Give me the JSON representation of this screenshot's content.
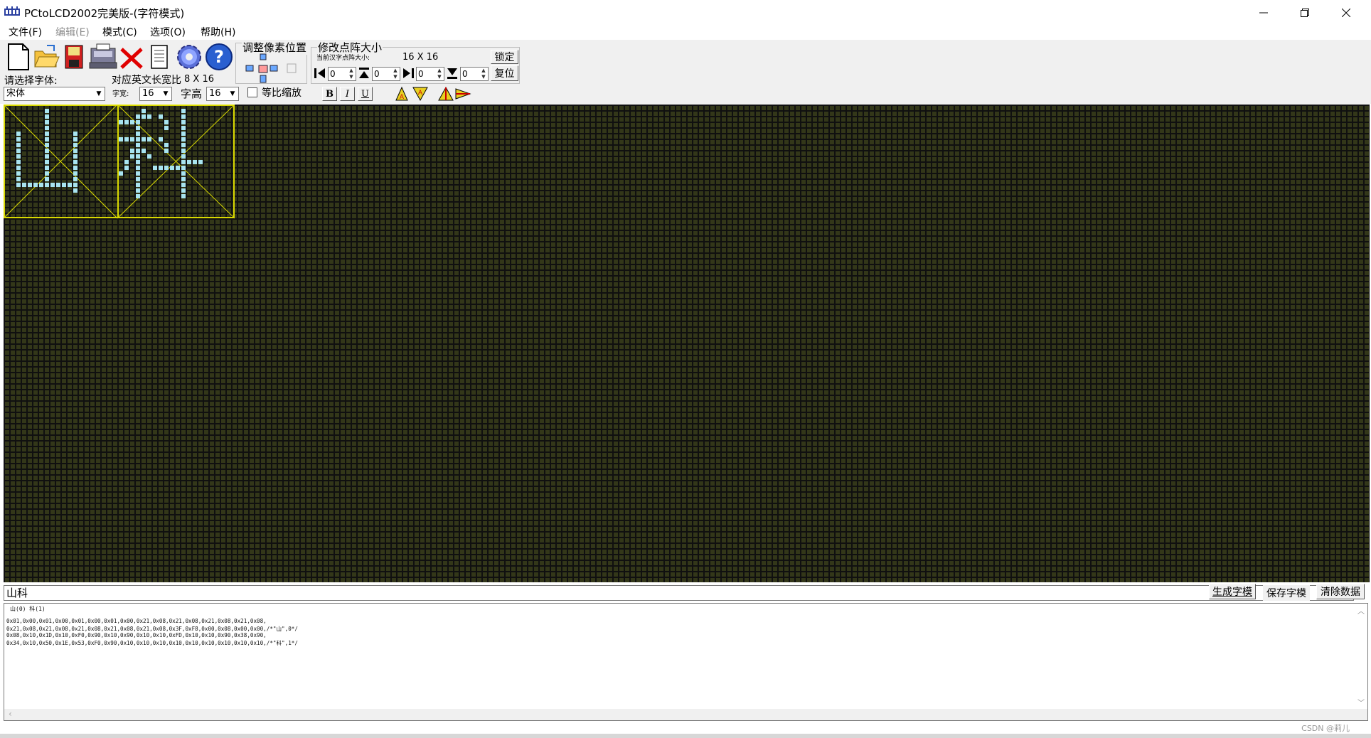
{
  "window": {
    "title": "PCtoLCD2002完美版-(字符模式)",
    "minimize": "−",
    "restore": "❐",
    "close": "✕"
  },
  "menu": [
    {
      "label": "文件(F)",
      "enabled": true
    },
    {
      "label": "编辑(E)",
      "enabled": false
    },
    {
      "label": "模式(C)",
      "enabled": true
    },
    {
      "label": "选项(O)",
      "enabled": true
    },
    {
      "label": "帮助(H)",
      "enabled": true
    }
  ],
  "toolbar": {
    "font_label": "请选择字体:",
    "font_value": "宋体",
    "ratio_label": "对应英文长宽比",
    "ratio_value": "8 X 16",
    "char_width_label": "字宽:",
    "char_width_value": "16",
    "char_height_label": "字高",
    "char_height_value": "16",
    "proportional_label": "等比缩放",
    "bold": "B",
    "italic": "I",
    "underline": "U",
    "adjust_title": "调整像素位置",
    "resize_title": "修改点阵大小",
    "current_size_label": "当前汉字点阵大小:",
    "current_size_value": "16 X 16",
    "lock_button": "锁定",
    "reset_button": "复位",
    "spin_values": [
      "0",
      "0",
      "0",
      "0"
    ]
  },
  "editor": {
    "chars": [
      "山",
      "科"
    ]
  },
  "bottom": {
    "input_text": "山科",
    "generate_button": "生成字模",
    "save_button": "保存字模",
    "clear_button": "清除数据",
    "output_header": "山(0) 科(1)",
    "output_lines": [
      "0x01,0x00,0x01,0x00,0x01,0x00,0x01,0x00,0x21,0x08,0x21,0x08,0x21,0x08,0x21,0x08,",
      "0x21,0x08,0x21,0x08,0x21,0x08,0x21,0x08,0x21,0x08,0x3F,0xF8,0x00,0x08,0x00,0x00,/*\"山\",0*/",
      "0x08,0x10,0x1D,0x10,0xF0,0x90,0x10,0x90,0x10,0x10,0xFD,0x10,0x10,0x90,0x38,0x90,",
      "0x34,0x10,0x50,0x1E,0x53,0xF0,0x90,0x10,0x10,0x10,0x10,0x10,0x10,0x10,0x10,0x10,/*\"科\",1*/"
    ],
    "watermark": "CSDN @莉儿"
  },
  "colors": {
    "grid_cell": "#333719",
    "grid_line": "#101010",
    "pixel_on": "#a8e4f0",
    "char_border": "#d8d800"
  }
}
